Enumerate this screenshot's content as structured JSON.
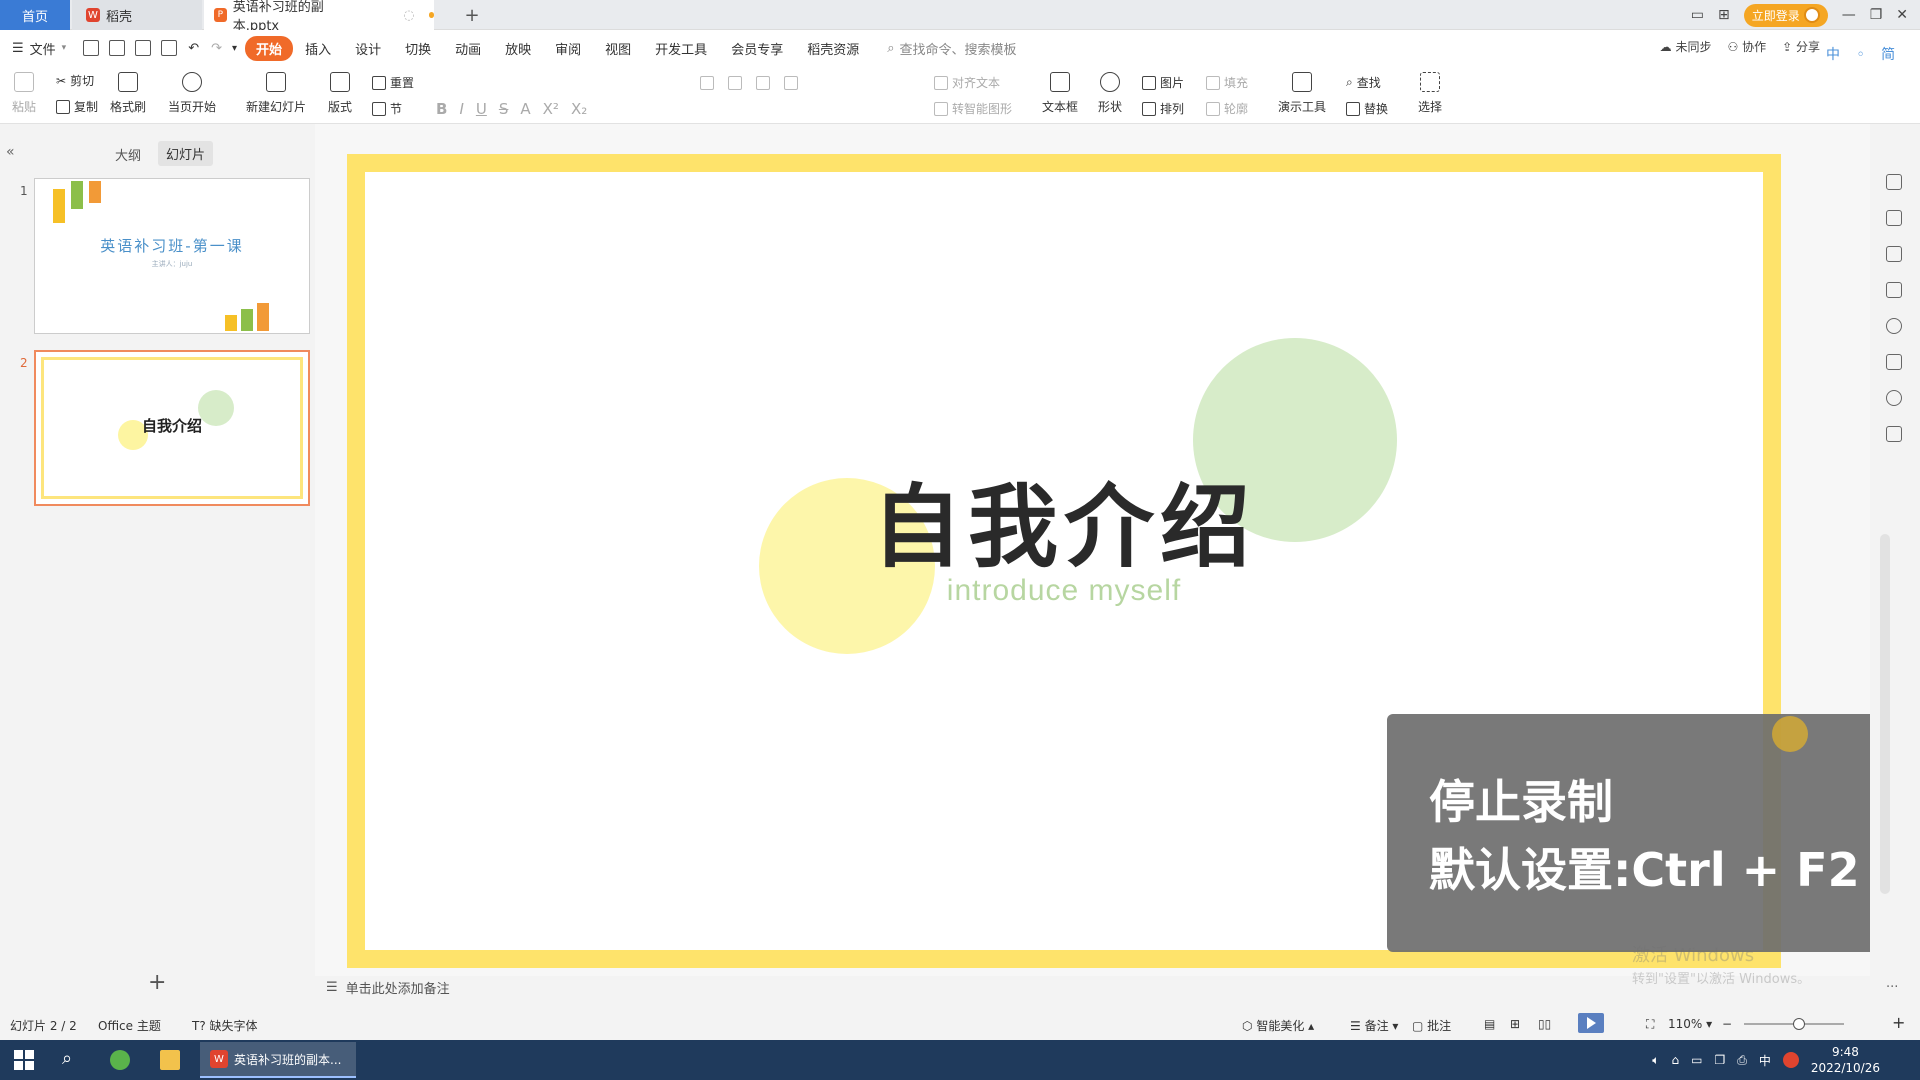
{
  "tabs": {
    "home": "首页",
    "daoke": "稻壳",
    "document": "英语补习班的副本.pptx",
    "add": "+"
  },
  "window": {
    "login": "立即登录"
  },
  "menu": {
    "file": "文件",
    "items": [
      "开始",
      "插入",
      "设计",
      "切换",
      "动画",
      "放映",
      "审阅",
      "视图",
      "开发工具",
      "会员专享",
      "稻壳资源"
    ],
    "search_placeholder": "查找命令、搜索模板",
    "right": [
      "未同步",
      "协作",
      "分享"
    ]
  },
  "ribbon": {
    "paste": "粘贴",
    "cut": "剪切",
    "copy": "复制",
    "format_painter": "格式刷",
    "from_current": "当页开始",
    "new_slide": "新建幻灯片",
    "layout": "版式",
    "section": "节",
    "reset": "重置",
    "align_text": "对齐文本",
    "smart_art": "转智能图形",
    "textbox": "文本框",
    "shape": "形状",
    "picture": "图片",
    "fill": "填充",
    "arrange": "排列",
    "outline": "轮廓",
    "presentation_tools": "演示工具",
    "find": "查找",
    "replace": "替换",
    "select": "选择"
  },
  "left_panel": {
    "outline_tab": "大纲",
    "slides_tab": "幻灯片",
    "thumb1_num": "1",
    "thumb1_title": "英语补习班-第一课",
    "thumb1_sub": "主讲人：juju",
    "thumb2_num": "2",
    "thumb2_title": "自我介绍"
  },
  "slide": {
    "title": "自我介绍",
    "subtitle": "introduce myself"
  },
  "overlay": {
    "line1": "停止录制",
    "line2": "默认设置:Ctrl + F2"
  },
  "watermark": {
    "line1": "激活 Windows",
    "line2": "转到\"设置\"以激活 Windows。"
  },
  "ime": "中 ◦ 简",
  "notes_placeholder": "单击此处添加备注",
  "status": {
    "slide_counter": "幻灯片 2 / 2",
    "theme": "Office 主题",
    "missing_font": "缺失字体",
    "beautify": "智能美化",
    "notes": "备注",
    "comments": "批注",
    "zoom": "110%",
    "zoom_level": 0.55
  },
  "taskbar": {
    "app_title": "英语补习班的副本...",
    "time": "9:48",
    "date": "2022/10/26",
    "ime": "中"
  },
  "colors": {
    "accent": "#f06a29",
    "slide_border": "#fee36b",
    "subtitle_green": "#b7d6a1"
  }
}
